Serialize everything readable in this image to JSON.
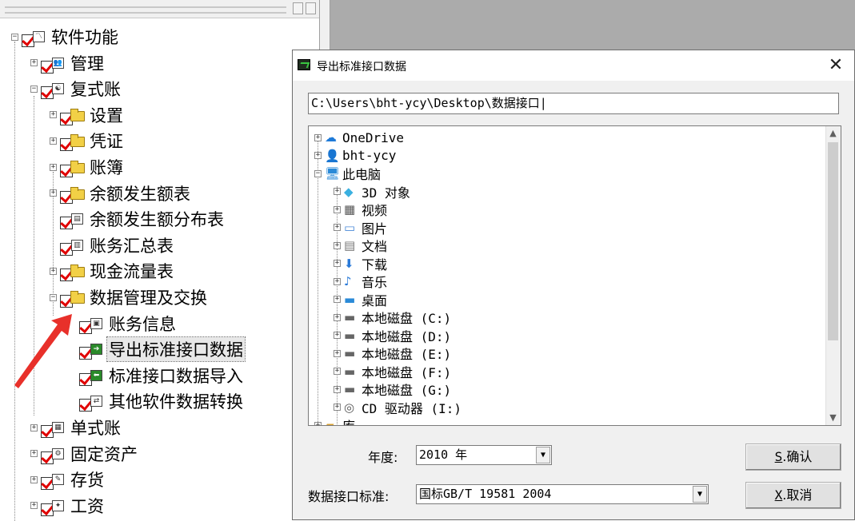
{
  "tree": {
    "items": [
      {
        "label": "软件功能",
        "expander": "minus",
        "icon": "chart-icon"
      },
      {
        "label": "管理",
        "expander": "plus",
        "icon": "users-icon"
      },
      {
        "label": "复式账",
        "expander": "minus",
        "icon": "yin-yang-icon"
      },
      {
        "label": "设置",
        "expander": "plus",
        "icon": "folder-icon"
      },
      {
        "label": "凭证",
        "expander": "plus",
        "icon": "folder-icon"
      },
      {
        "label": "账簿",
        "expander": "plus",
        "icon": "folder-icon"
      },
      {
        "label": "余额发生额表",
        "expander": "plus",
        "icon": "folder-icon"
      },
      {
        "label": "余额发生额分布表",
        "expander": "none",
        "icon": "report-icon"
      },
      {
        "label": "账务汇总表",
        "expander": "none",
        "icon": "document-icon"
      },
      {
        "label": "现金流量表",
        "expander": "plus",
        "icon": "folder-icon"
      },
      {
        "label": "数据管理及交换",
        "expander": "minus",
        "icon": "open-folder-icon"
      },
      {
        "label": "账务信息",
        "expander": "none",
        "icon": "database-icon"
      },
      {
        "label": "导出标准接口数据",
        "expander": "none",
        "icon": "export-icon",
        "selected": true
      },
      {
        "label": "标准接口数据导入",
        "expander": "none",
        "icon": "import-icon"
      },
      {
        "label": "其他软件数据转换",
        "expander": "none",
        "icon": "convert-icon"
      },
      {
        "label": "单式账",
        "expander": "plus",
        "icon": "sm-icon"
      },
      {
        "label": "固定资产",
        "expander": "plus",
        "icon": "asset-icon"
      },
      {
        "label": "存货",
        "expander": "plus",
        "icon": "inventory-icon"
      },
      {
        "label": "工资",
        "expander": "plus",
        "icon": "salary-icon"
      }
    ]
  },
  "dialog": {
    "title": "导出标准接口数据",
    "close_glyph": "✕",
    "path": "C:\\Users\\bht-ycy\\Desktop\\数据接口",
    "folders": [
      {
        "label": "OneDrive",
        "level": 0,
        "icon": "cloud-icon"
      },
      {
        "label": "bht-ycy",
        "level": 0,
        "icon": "user-icon"
      },
      {
        "label": "此电脑",
        "level": 0,
        "icon": "computer-icon",
        "expanded": true
      },
      {
        "label": "3D 对象",
        "level": 1,
        "icon": "3d-objects-icon"
      },
      {
        "label": "视频",
        "level": 1,
        "icon": "video-icon"
      },
      {
        "label": "图片",
        "level": 1,
        "icon": "pictures-icon"
      },
      {
        "label": "文档",
        "level": 1,
        "icon": "documents-icon"
      },
      {
        "label": "下载",
        "level": 1,
        "icon": "download-icon"
      },
      {
        "label": "音乐",
        "level": 1,
        "icon": "music-icon"
      },
      {
        "label": "桌面",
        "level": 1,
        "icon": "desktop-icon"
      },
      {
        "label": "本地磁盘 (C:)",
        "level": 1,
        "icon": "system-drive-icon"
      },
      {
        "label": "本地磁盘 (D:)",
        "level": 1,
        "icon": "drive-icon"
      },
      {
        "label": "本地磁盘 (E:)",
        "level": 1,
        "icon": "drive-icon"
      },
      {
        "label": "本地磁盘 (F:)",
        "level": 1,
        "icon": "drive-icon"
      },
      {
        "label": "本地磁盘 (G:)",
        "level": 1,
        "icon": "drive-icon"
      },
      {
        "label": "CD 驱动器 (I:)",
        "level": 1,
        "icon": "cd-drive-icon"
      },
      {
        "label": "库",
        "level": 0,
        "icon": "library-icon"
      }
    ],
    "year_label": "年度:",
    "year_value": "2010 年",
    "standard_label": "数据接口标准:",
    "standard_value": "国标GB/T 19581 2004",
    "confirm_key": "S",
    "confirm_text": ".确认",
    "cancel_key": "X",
    "cancel_text": ".取消"
  },
  "colors": {
    "checkmark": "#e00000",
    "arrow": "#e8302a",
    "folder": "#f2d046",
    "background_gray": "#ababab"
  }
}
